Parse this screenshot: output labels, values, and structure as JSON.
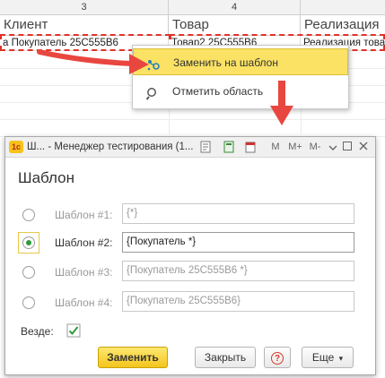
{
  "sheet": {
    "col_numbers": [
      "3",
      "4"
    ],
    "headers": [
      "Клиент",
      "Товар",
      "Реализация"
    ],
    "row": [
      "а Покупатель 25С555В6",
      "Товар2 25С555В6",
      "Реализация това"
    ]
  },
  "context_menu": {
    "items": [
      {
        "label": "Заменить на шаблон",
        "icon": "replace-template-icon",
        "highlighted": true
      },
      {
        "label": "Отметить область",
        "icon": "magnifier-icon",
        "highlighted": false
      }
    ]
  },
  "dialog": {
    "logo": "1c",
    "title": "Ш... - Менеджер тестирования (1...",
    "toolbar_icons": [
      "document-icon",
      "calculator-icon",
      "calendar-icon"
    ],
    "toolbar_text": [
      "M",
      "M+",
      "M-"
    ],
    "window_icons": [
      "menu-icon",
      "restore-icon",
      "close-icon"
    ],
    "heading": "Шаблон",
    "rows": [
      {
        "label": "Шаблон #1:",
        "value": "{*}",
        "selected": false
      },
      {
        "label": "Шаблон #2:",
        "value": "{Покупатель *}",
        "selected": true
      },
      {
        "label": "Шаблон #3:",
        "value": "{Покупатель 25С555В6 *}",
        "selected": false
      },
      {
        "label": "Шаблон #4:",
        "value": "{Покупатель 25С555В6}",
        "selected": false
      }
    ],
    "everywhere_label": "Везде:",
    "everywhere_checked": true,
    "buttons": {
      "replace": "Заменить",
      "close": "Закрыть",
      "help": "?",
      "more": "Еще",
      "more_arrow": "▾"
    }
  },
  "colors": {
    "highlight": "#fbe264",
    "selection_border": "#e0322a",
    "arrow": "#e8463f",
    "radio_on": "#2e9a3a"
  }
}
